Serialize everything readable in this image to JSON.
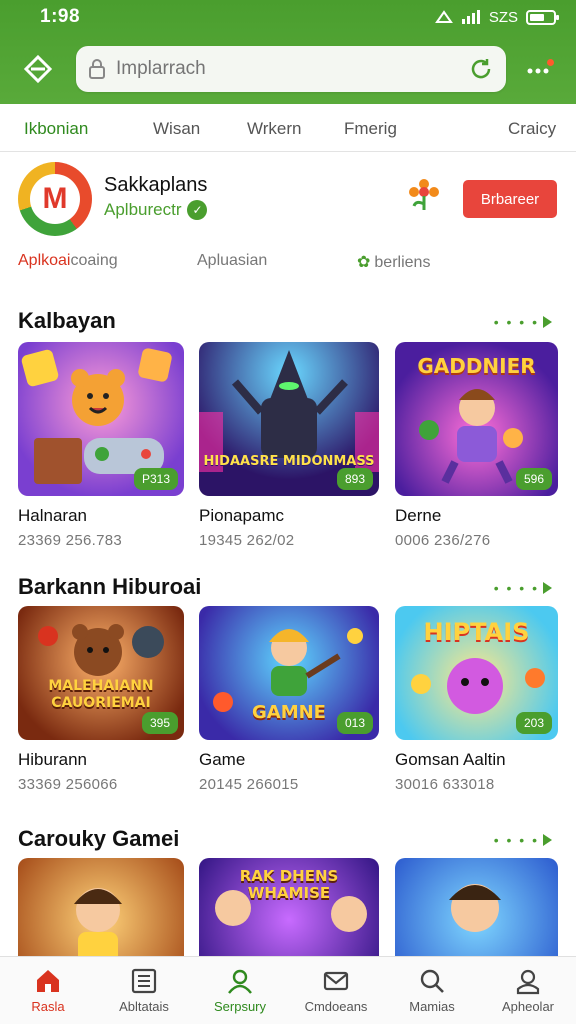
{
  "status": {
    "time": "1:98",
    "network": "SZS"
  },
  "search": {
    "placeholder": "Implarrach"
  },
  "tabs": [
    "Ikbonian",
    "Wisan",
    "Wrkern",
    "Fmerig",
    "Craicy"
  ],
  "app": {
    "name": "Sakkaplans",
    "subtitle": "Aplburectr",
    "install_label": "Brbareer",
    "logo_letter": "M"
  },
  "sublinks": {
    "first_red": "Aplkoai",
    "first_rest": "coaing",
    "second": "Apluasian",
    "third": "berliens"
  },
  "sections": [
    {
      "title": "Kalbayan",
      "items": [
        {
          "title": "Halnaran",
          "meta": "23369 256.783",
          "badge": "P313"
        },
        {
          "title": "Pionapamc",
          "meta": "19345 262/02",
          "badge": "893",
          "art": "HIDAASRE MIDONMASS"
        },
        {
          "title": "Derne",
          "meta": "0006 236/276",
          "badge": "596",
          "art": "GADDNIER"
        }
      ]
    },
    {
      "title": "Barkann Hiburoai",
      "items": [
        {
          "title": "Hiburann",
          "meta": "33369 256066",
          "badge": "395",
          "art": "MALEHAIANN CAUORIEMAI"
        },
        {
          "title": "Game",
          "meta": "20145 266015",
          "badge": "013",
          "art": "GAMNE"
        },
        {
          "title": "Gomsan Aaltin",
          "meta": "30016 633018",
          "badge": "203",
          "art": "HIPTAIS"
        }
      ]
    },
    {
      "title": "Carouky Gamei",
      "items": [
        {
          "title": "",
          "meta": "",
          "badge": ""
        },
        {
          "title": "",
          "meta": "",
          "badge": "",
          "art": "RAK DHENS WHAMISE"
        },
        {
          "title": "",
          "meta": "",
          "badge": ""
        }
      ]
    }
  ],
  "nav": [
    "Rasla",
    "Abltatais",
    "Serpsury",
    "Cmdoeans",
    "Mamias",
    "Apheolar"
  ],
  "colors": {
    "primary": "#4a9e2e",
    "accent": "#e8453c"
  }
}
